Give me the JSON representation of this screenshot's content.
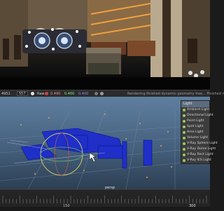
{
  "status_bar": {
    "field_a": "4951",
    "field_b": "557",
    "field_c": "Raw",
    "value_r": "0.490",
    "value_g": "0.400",
    "value_b": "0.400",
    "message": "Rendering finished dynamic geometry free... Finished ren"
  },
  "viewport": {
    "object_label": "persp"
  },
  "light_menu": {
    "title": "Light",
    "items": [
      {
        "label": "Ambient Light"
      },
      {
        "label": "Directional Light"
      },
      {
        "label": "Point Light"
      },
      {
        "label": "Spot Light"
      },
      {
        "label": "Area Light"
      },
      {
        "label": "Volume Light"
      },
      {
        "label": "V-Ray Sphere Light"
      },
      {
        "label": "V-Ray Dome Light"
      },
      {
        "label": "V-Ray Rect Light"
      },
      {
        "label": "V-Ray IES Light"
      }
    ]
  },
  "timeline": {
    "tick_label": "150",
    "current_frame": "300"
  },
  "colors": {
    "menu_highlight": "#5c6c7f",
    "light_icon": "#9acb5a",
    "viewport_sky": "#5f7fa0",
    "selection_blue": "#1f2fc8"
  }
}
